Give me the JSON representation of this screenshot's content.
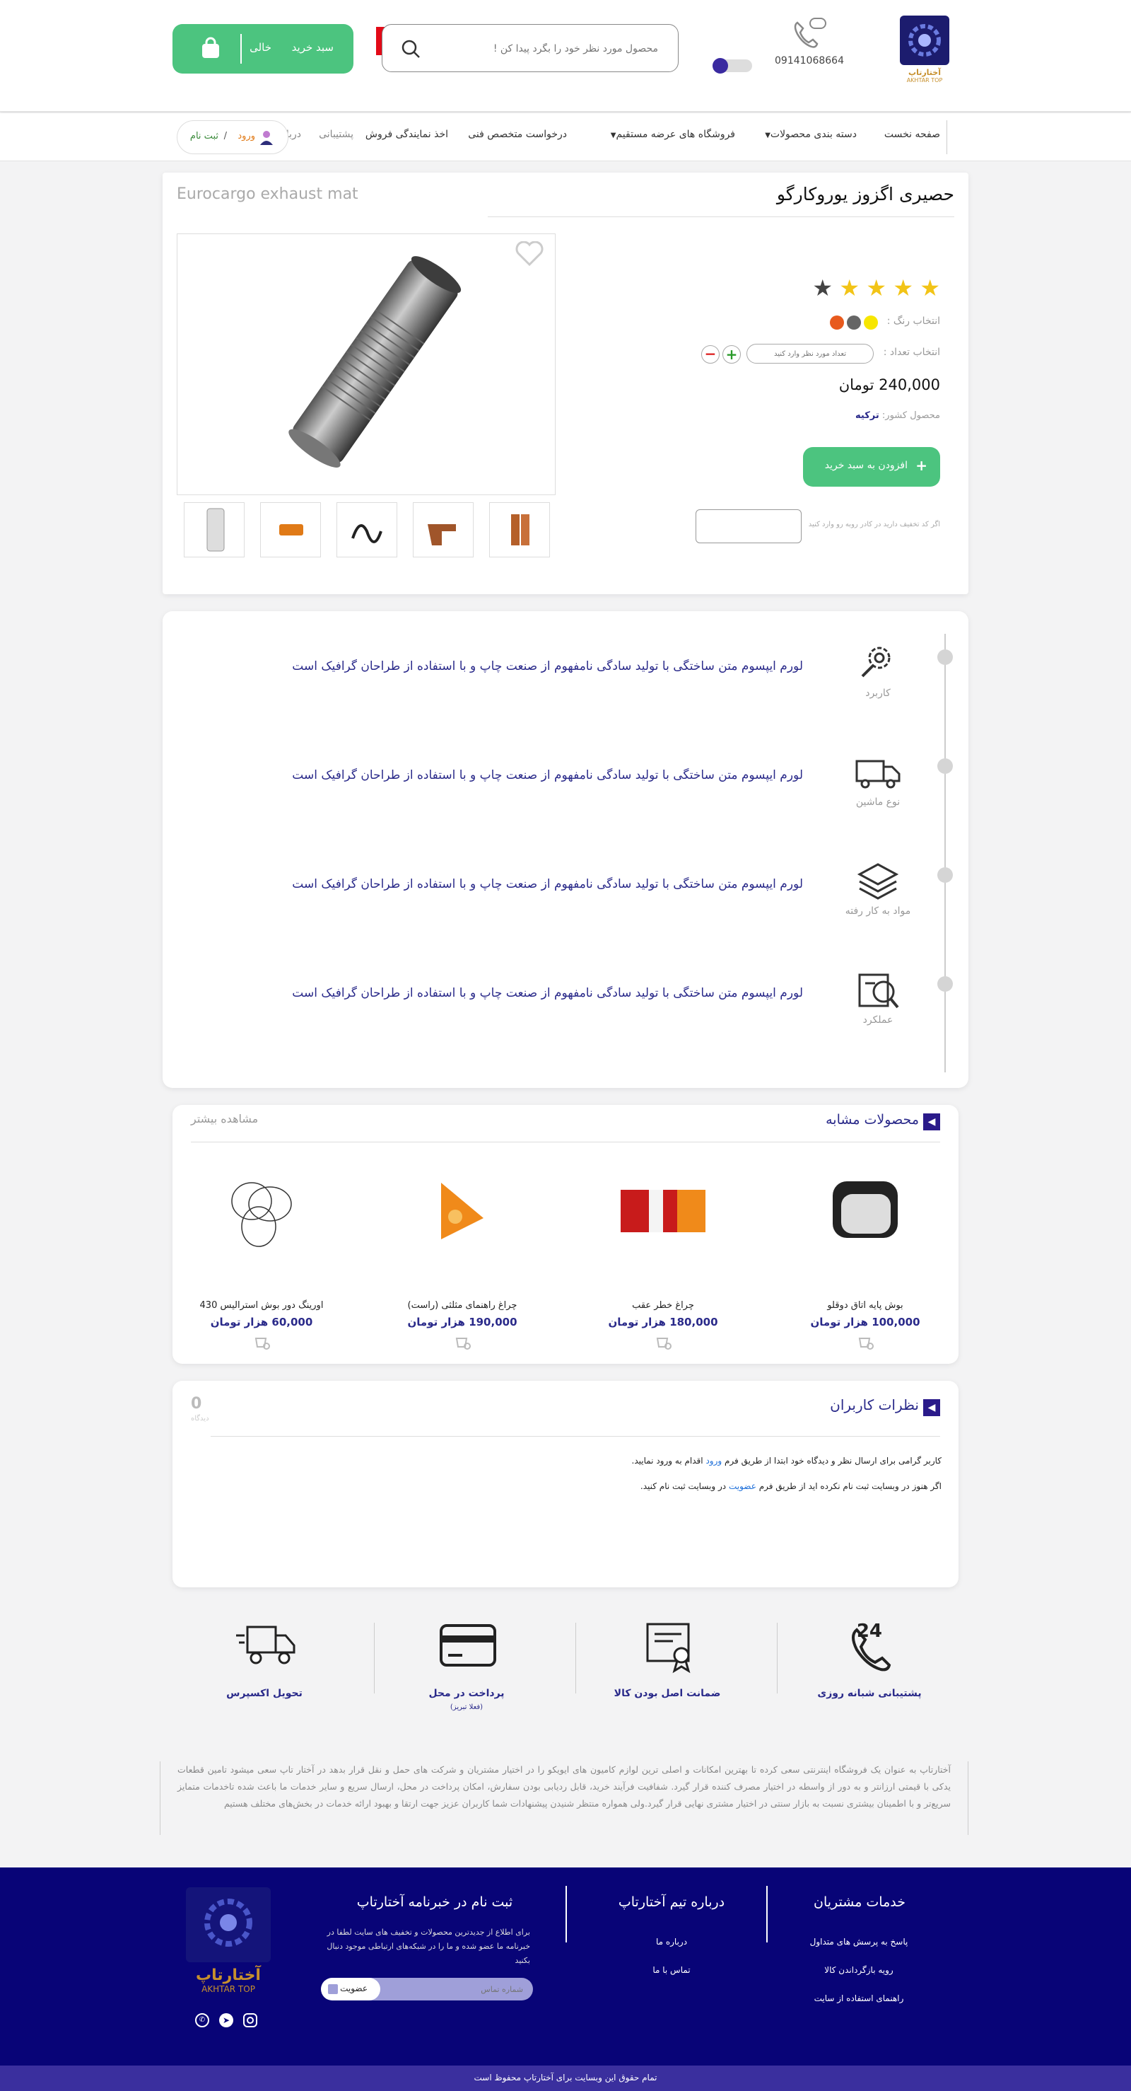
{
  "header": {
    "phone": "09141068664",
    "search_placeholder": "محصول مورد نظر خود را بگرد پیدا کن !",
    "cart_label": "سبد خرید",
    "cart_status": "خالی",
    "logo_text": "آختارتاپ",
    "logo_sub": "AKHTAR TOP"
  },
  "nav": {
    "items": [
      "صفحه نخست",
      "دسته بندی محصولات",
      "فروشگاه های عرضه مستقیم",
      "درخواست متخصص فنی",
      "اخذ نمایندگی فروش",
      "پشتیبانی",
      "درباره ما"
    ],
    "login": "ورود",
    "register": "ثبت نام",
    "sep": "/"
  },
  "product": {
    "title": "حصیری اگزوز یوروکارگو",
    "title_en": "Eurocargo exhaust mat",
    "color_label": "انتخاب رنگ :",
    "qty_label": "انتخاب تعداد :",
    "qty_placeholder": "تعداد مورد نظر وارد کنید",
    "price": "240,000 تومان",
    "country_label": "محصول کشور:",
    "country": "ترکیه",
    "add_to_cart": "افزودن به سبد خرید",
    "discount_label": "اگر کد تخفیف دارید در کادر روبه رو وارد کنید",
    "rating": 4,
    "colors": [
      "#f7e600",
      "#666666",
      "#e85a1d"
    ]
  },
  "features": [
    {
      "label": "کاربرد",
      "text": "لورم ایپسوم متن ساختگی با تولید سادگی نامفهوم از صنعت چاپ و با استفاده از طراحان گرافیک است",
      "icon": "gear-wrench-icon"
    },
    {
      "label": "نوع ماشین",
      "text": "لورم ایپسوم متن ساختگی با تولید سادگی نامفهوم از صنعت چاپ و با استفاده از طراحان گرافیک است",
      "icon": "truck-icon"
    },
    {
      "label": "مواد به کار رفته",
      "text": "لورم ایپسوم متن ساختگی با تولید سادگی نامفهوم از صنعت چاپ و با استفاده از طراحان گرافیک است",
      "icon": "layers-icon"
    },
    {
      "label": "عملکرد",
      "text": "لورم ایپسوم متن ساختگی با تولید سادگی نامفهوم از صنعت چاپ و با استفاده از طراحان گرافیک است",
      "icon": "performance-icon"
    }
  ],
  "similar": {
    "title": "محصولات مشابه",
    "more": "مشاهده بیشتر",
    "items": [
      {
        "name": "بوش پایه اتاق دوقلو",
        "price": "100,000 هزار تومان"
      },
      {
        "name": "چراغ خطر عقب",
        "price": "180,000 هزار تومان"
      },
      {
        "name": "چراغ راهنمای مثلثی (راست)",
        "price": "190,000 هزار تومان"
      },
      {
        "name": "اورینگ دور بوش استرالیس 430",
        "price": "60,000 هزار تومان"
      }
    ]
  },
  "comments": {
    "title": "نظرات کاربران",
    "count": "0",
    "count_label": "دیدگاه",
    "line1_a": "کاربر گرامی برای ارسال نظر و دیدگاه خود ابتدا از طریق فرم",
    "line1_link": "ورود",
    "line1_b": "اقدام به ورود نمایید.",
    "line2_a": "اگر هنوز در وبسایت ثبت نام نکرده اید از طریق فرم",
    "line2_link": "عضویت",
    "line2_b": "در وبسایت ثبت نام کنید."
  },
  "services": [
    {
      "label": "پشتیبانی شبانه روزی",
      "sub": "",
      "icon": "phone-24-icon"
    },
    {
      "label": "ضمانت اصل بودن کالا",
      "sub": "",
      "icon": "certificate-icon"
    },
    {
      "label": "پرداخت در محل",
      "sub": "(فعلا تبریز)",
      "icon": "credit-card-icon"
    },
    {
      "label": "تحویل اکسپرس",
      "sub": "",
      "icon": "delivery-truck-icon"
    }
  ],
  "about": "آختارتاپ     به عنوان یک فروشگاه اینترنتی سعی کرده تا بهترین امکانات و اصلی ترین لوازم کامیون های ایویکو را در اختیار مشتریان و شرکت های حمل و نقل قرار بدهد در آختار تاپ سعی میشود تامین قطعات یدکی با قیمتی ارزانتر و به دور از واسطه در اختیار مصرف کننده قرار گیرد. شفافیت فرآیند خرید، قابل ردیابی بودن سفارش، امکان پرداخت در محل، ارسال سریع و سایر خدمات ما باعث شده تاخدمات متمایز سریع‌تر و با اطمینان بیشتری نسبت به بازار سنتی در اختیار مشتری نهایی قرار گیرد.ولی همواره منتظر شنیدن پیشنهادات شما کاربران عزیز جهت ارتقا و بهبود ارائه خدمات در بخش‌های مختلف هستیم",
  "footer": {
    "services_title": "خدمات مشتریان",
    "services_links": [
      "پاسخ به پرسش های متداول",
      "رویه بازگرداندن کالا",
      "راهنمای استفاده از سایت"
    ],
    "team_title": "درباره تیم آختارتاپ",
    "team_links": [
      "درباره ما",
      "تماس با ما"
    ],
    "newsletter_title": "ثبت نام در خبرنامه آختارتاپ",
    "newsletter_text": "برای اطلاع از جدیدترین محصولات و تخفیف های سایت لطفا در خبرنامه ما عضو شده و ما را در شبکه‌های ارتباطی موجود دنبال بکنید",
    "newsletter_placeholder": "شماره تماس",
    "newsletter_button": "عضویت",
    "copyright": "تمام حقوق این وبسایت برای آختارتاپ محفوظ است"
  }
}
